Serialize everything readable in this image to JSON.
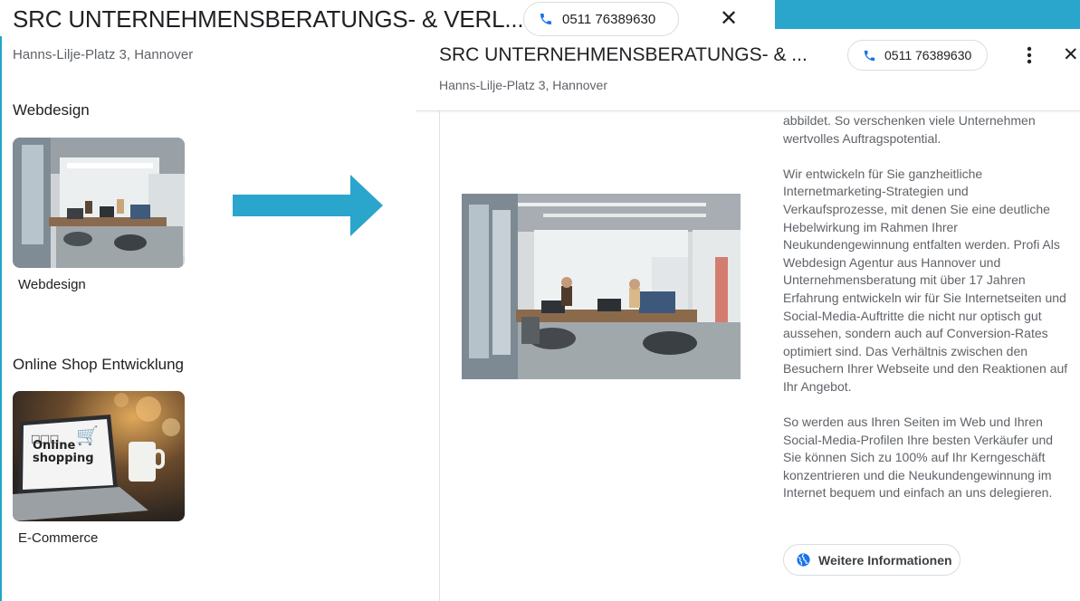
{
  "listing": {
    "title_full": "SRC UNTERNEHMENSBERATUNGS- & VERL...",
    "title_short": "SRC UNTERNEHMENSBERATUNGS- & ...",
    "phone": "0511 76389630",
    "address": "Hanns-Lilje-Platz 3, Hannover"
  },
  "left": {
    "sections": [
      {
        "heading": "Webdesign",
        "caption": "Webdesign"
      },
      {
        "heading": "Online Shop Entwicklung",
        "caption": "E-Commerce"
      }
    ],
    "laptop_screen_text": {
      "line1": "Online",
      "line2": "shopping"
    }
  },
  "right": {
    "paragraphs": [
      "abbildet. So verschenken viele Unternehmen wertvolles Auftragspotential.",
      "Wir entwickeln für Sie ganzheitliche Internetmarketing-Strategien und Verkaufsprozesse, mit denen Sie eine deutliche Hebelwirkung im Rahmen Ihrer Neukundengewinnung entfalten werden. Profi Als Webdesign Agentur aus Hannover und Unternehmensberatung mit über 17 Jahren Erfahrung entwickeln wir für Sie Internetseiten und Social-Media-Auftritte die nicht nur optisch gut aussehen, sondern auch auf Conversion-Rates optimiert sind. Das Verhältnis zwischen den Besuchern Ihrer Webseite und den Reaktionen auf Ihr Angebot.",
      "So werden aus Ihren Seiten im Web und Ihren Social-Media-Profilen Ihre besten Verkäufer und Sie können Sich zu 100% auf Ihr Kerngeschäft konzentrieren und die Neukundengewinnung im Internet bequem und einfach an uns delegieren."
    ],
    "more_info_label": "Weitere Informationen"
  },
  "colors": {
    "accent": "#2aa5cc",
    "phone_icon": "#1a73e8"
  }
}
